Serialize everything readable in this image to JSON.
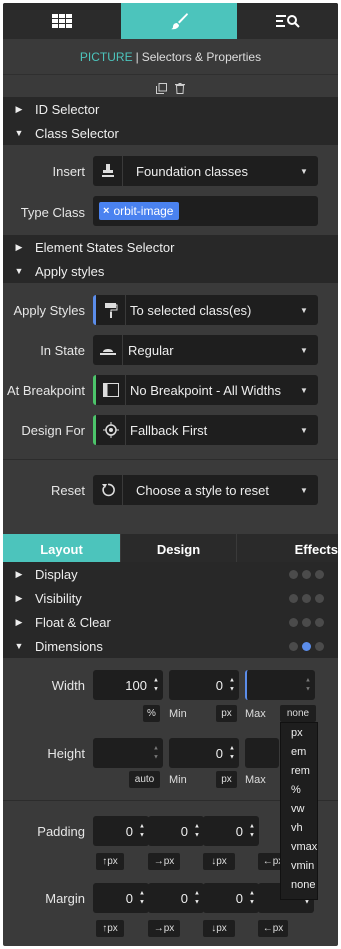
{
  "toolbar": {
    "tabs": [
      {
        "icon": "grid-icon"
      },
      {
        "icon": "brush-icon",
        "active": true
      },
      {
        "icon": "search-list-icon"
      }
    ]
  },
  "header": {
    "mode": "PICTURE",
    "title": "Selectors & Properties"
  },
  "sections": {
    "id_selector": "ID Selector",
    "class_selector": "Class Selector",
    "element_states": "Element States Selector",
    "apply_styles": "Apply styles"
  },
  "class_selector": {
    "insert_label": "Insert",
    "insert_value": "Foundation classes",
    "type_class_label": "Type Class",
    "tag": "orbit-image"
  },
  "apply": {
    "apply_styles_label": "Apply Styles",
    "apply_styles_value": "To selected class(es)",
    "in_state_label": "In State",
    "in_state_value": "Regular",
    "breakpoint_label": "At Breakpoint",
    "breakpoint_value": "No Breakpoint - All Widths",
    "design_for_label": "Design For",
    "design_for_value": "Fallback First",
    "reset_label": "Reset",
    "reset_value": "Choose a style to reset"
  },
  "subtabs": [
    "Layout",
    "Design",
    "Effects"
  ],
  "groups": {
    "display": "Display",
    "visibility": "Visibility",
    "float_clear": "Float & Clear",
    "dimensions": "Dimensions"
  },
  "dimensions": {
    "width_label": "Width",
    "width_value": "100",
    "width_unit": "%",
    "min_label": "Min",
    "min_value": "0",
    "min_unit": "px",
    "max_label": "Max",
    "max_unit": "none",
    "height_label": "Height",
    "height_unit": "auto",
    "height_min_value": "0",
    "height_min_unit": "px",
    "height_max_label": "Max"
  },
  "spacing": {
    "padding_label": "Padding",
    "margin_label": "Margin",
    "values": [
      "0",
      "0",
      "0"
    ],
    "units": [
      "↑px",
      "→px",
      "↓px",
      "←px"
    ]
  },
  "unit_dropdown": [
    "px",
    "em",
    "rem",
    "%",
    "vw",
    "vh",
    "vmax",
    "vmin",
    "none"
  ]
}
